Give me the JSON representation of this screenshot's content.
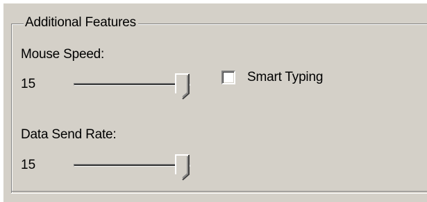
{
  "group": {
    "title": "Additional Features"
  },
  "mouse_speed": {
    "label": "Mouse Speed:",
    "value_text": "15",
    "level": 1.0
  },
  "data_send_rate": {
    "label": "Data Send Rate:",
    "value_text": "15",
    "level": 1.0
  },
  "smart_typing": {
    "label": "Smart Typing",
    "checked": false
  },
  "colors": {
    "face": "#d4d0c8",
    "shadow": "#808080",
    "highlight": "#ffffff"
  },
  "icons": {
    "slider_thumb": "slider-thumb-icon",
    "checkbox": "checkbox-icon"
  }
}
